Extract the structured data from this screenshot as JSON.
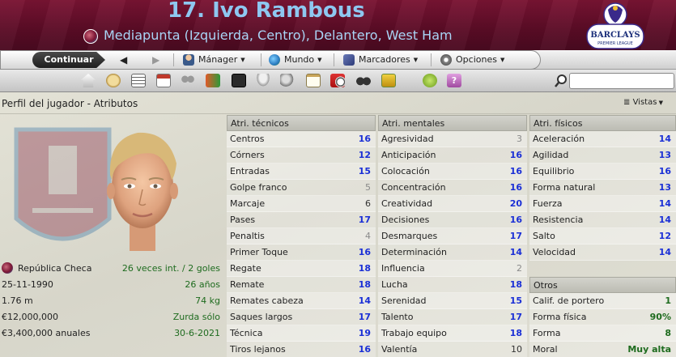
{
  "header": {
    "title": "17. Ivo Rambous",
    "subtitle": "Mediapunta (Izquierda, Centro), Delantero, West Ham",
    "league_logo_text": "BARCLAYS",
    "league_logo_sub": "PREMIER LEAGUE"
  },
  "nav": {
    "continue": "Continuar",
    "back_icon": "back-arrow-icon",
    "forward_icon": "forward-arrow-icon",
    "manager": "Mánager",
    "world": "Mundo",
    "bookmarks": "Marcadores",
    "options": "Opciones"
  },
  "toolbar": {
    "icons": [
      "home-icon",
      "bread-icon",
      "news-icon",
      "calendar-icon",
      "squad-icon",
      "transfer-icon",
      "tactics-icon",
      "trophy-icon",
      "staff-icon",
      "clipboard-icon",
      "training-icon",
      "scouting-icon",
      "finances-icon",
      "help-icon",
      "question-icon"
    ]
  },
  "search": {
    "placeholder": ""
  },
  "panel": {
    "title": "Perfil del jugador - Atributos",
    "views": "Vistas"
  },
  "info": [
    {
      "label": "República Checa",
      "value": "26 veces int. / 2 goles"
    },
    {
      "label": "25-11-1990",
      "value": "26 años"
    },
    {
      "label": "1.76 m",
      "value": "74 kg"
    },
    {
      "label": "€12,000,000",
      "value": "Zurda sólo"
    },
    {
      "label": "€3,400,000 anuales",
      "value": "30-6-2021"
    }
  ],
  "technical": {
    "header": "Atri. técnicos",
    "rows": [
      {
        "name": "Centros",
        "value": "16",
        "style": "blue"
      },
      {
        "name": "Córners",
        "value": "12",
        "style": "blue"
      },
      {
        "name": "Entradas",
        "value": "15",
        "style": "blue"
      },
      {
        "name": "Golpe franco",
        "value": "5",
        "style": "grey"
      },
      {
        "name": "Marcaje",
        "value": "6",
        "style": "dark"
      },
      {
        "name": "Pases",
        "value": "17",
        "style": "blue"
      },
      {
        "name": "Penaltis",
        "value": "4",
        "style": "grey"
      },
      {
        "name": "Primer Toque",
        "value": "16",
        "style": "blue"
      },
      {
        "name": "Regate",
        "value": "18",
        "style": "blue"
      },
      {
        "name": "Remate",
        "value": "18",
        "style": "blue"
      },
      {
        "name": "Remates cabeza",
        "value": "14",
        "style": "blue"
      },
      {
        "name": "Saques largos",
        "value": "17",
        "style": "blue"
      },
      {
        "name": "Técnica",
        "value": "19",
        "style": "blue"
      },
      {
        "name": "Tiros lejanos",
        "value": "16",
        "style": "blue"
      }
    ]
  },
  "mental": {
    "header": "Atri. mentales",
    "rows": [
      {
        "name": "Agresividad",
        "value": "3",
        "style": "grey"
      },
      {
        "name": "Anticipación",
        "value": "16",
        "style": "blue"
      },
      {
        "name": "Colocación",
        "value": "16",
        "style": "blue"
      },
      {
        "name": "Concentración",
        "value": "16",
        "style": "blue"
      },
      {
        "name": "Creatividad",
        "value": "20",
        "style": "blue"
      },
      {
        "name": "Decisiones",
        "value": "16",
        "style": "blue"
      },
      {
        "name": "Desmarques",
        "value": "17",
        "style": "blue"
      },
      {
        "name": "Determinación",
        "value": "14",
        "style": "blue"
      },
      {
        "name": "Influencia",
        "value": "2",
        "style": "grey"
      },
      {
        "name": "Lucha",
        "value": "18",
        "style": "blue"
      },
      {
        "name": "Serenidad",
        "value": "15",
        "style": "blue"
      },
      {
        "name": "Talento",
        "value": "17",
        "style": "blue"
      },
      {
        "name": "Trabajo equipo",
        "value": "18",
        "style": "blue"
      },
      {
        "name": "Valentía",
        "value": "10",
        "style": "dark"
      }
    ]
  },
  "physical": {
    "header": "Atri. físicos",
    "rows": [
      {
        "name": "Aceleración",
        "value": "14",
        "style": "blue"
      },
      {
        "name": "Agilidad",
        "value": "13",
        "style": "blue"
      },
      {
        "name": "Equilibrio",
        "value": "16",
        "style": "blue"
      },
      {
        "name": "Forma natural",
        "value": "13",
        "style": "blue"
      },
      {
        "name": "Fuerza",
        "value": "14",
        "style": "blue"
      },
      {
        "name": "Resistencia",
        "value": "14",
        "style": "blue"
      },
      {
        "name": "Salto",
        "value": "12",
        "style": "blue"
      },
      {
        "name": "Velocidad",
        "value": "14",
        "style": "blue"
      }
    ]
  },
  "others": {
    "header": "Otros",
    "rows": [
      {
        "name": "Calif. de portero",
        "value": "1",
        "style": "green"
      },
      {
        "name": "Forma física",
        "value": "90%",
        "style": "green"
      },
      {
        "name": "Forma",
        "value": "8",
        "style": "green"
      },
      {
        "name": "Moral",
        "value": "Muy alta",
        "style": "green"
      }
    ]
  }
}
